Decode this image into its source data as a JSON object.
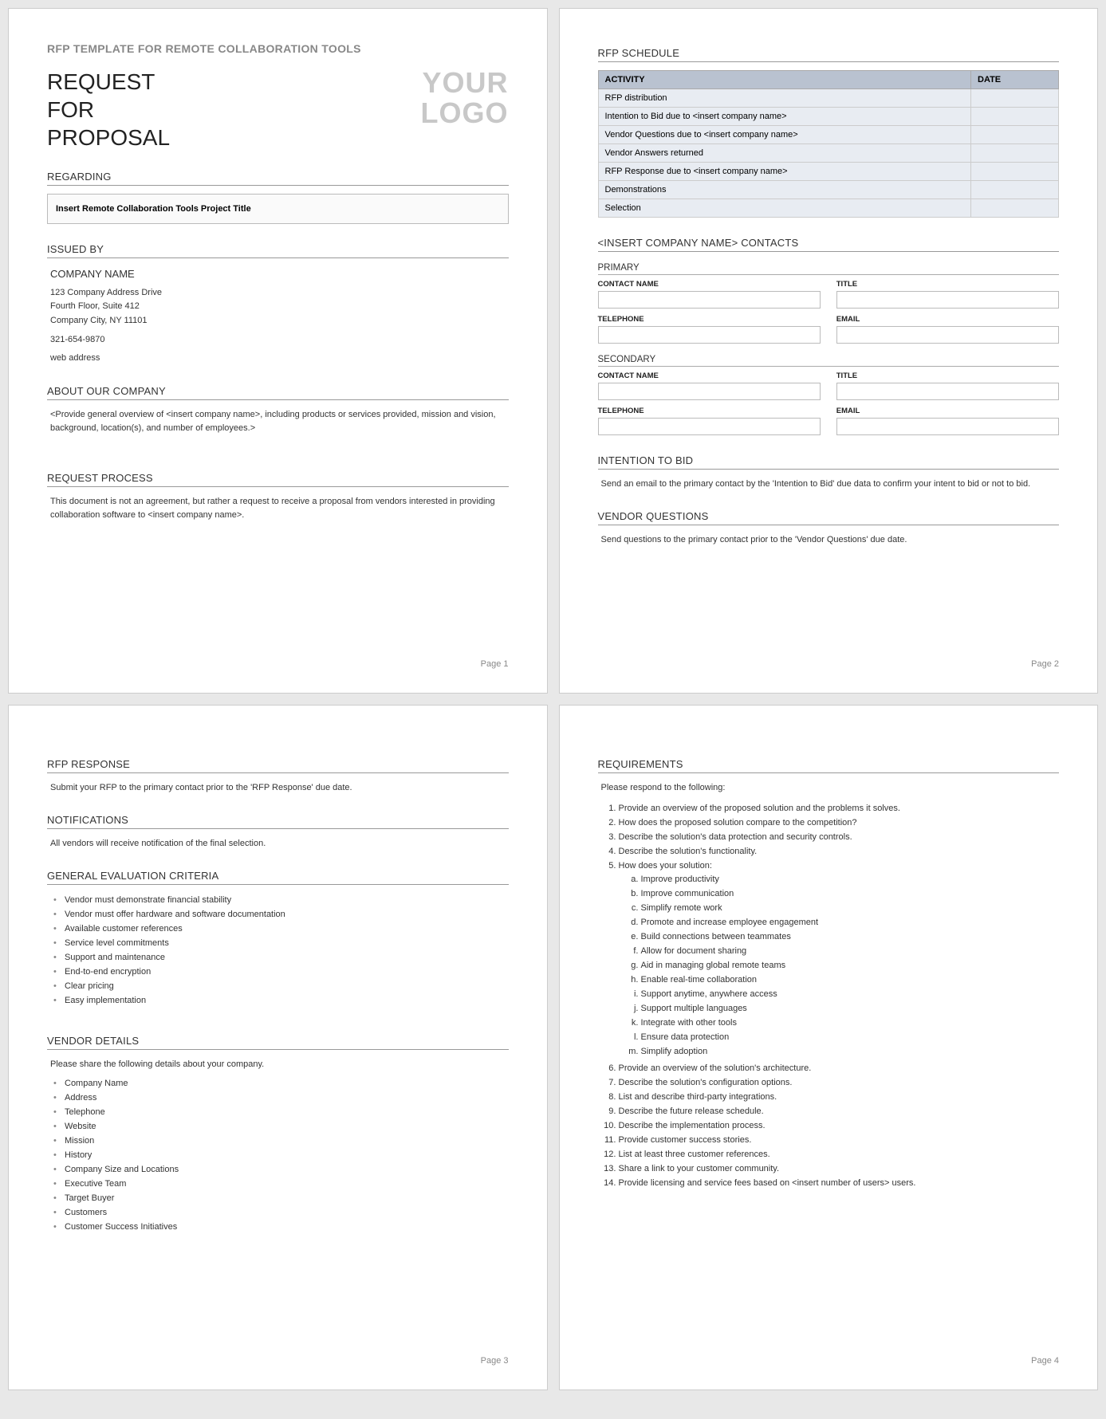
{
  "header": {
    "subtitle": "RFP TEMPLATE FOR REMOTE COLLABORATION TOOLS",
    "title": "REQUEST\nFOR\nPROPOSAL",
    "logo_line1": "YOUR",
    "logo_line2": "LOGO"
  },
  "regarding": {
    "heading": "REGARDING",
    "value": "Insert Remote Collaboration Tools Project Title"
  },
  "issued_by": {
    "heading": "ISSUED BY",
    "company": "COMPANY NAME",
    "addr1": "123 Company Address Drive",
    "addr2": "Fourth Floor, Suite 412",
    "addr3": "Company City, NY  11101",
    "phone": "321-654-9870",
    "web": "web address"
  },
  "about": {
    "heading": "ABOUT OUR COMPANY",
    "text": "<Provide general overview of <insert company name>, including products or services provided, mission and vision, background, location(s), and number of employees.>"
  },
  "process": {
    "heading": "REQUEST PROCESS",
    "text": "This document is not an agreement, but rather a request to receive a proposal from vendors interested in providing collaboration software to <insert company name>."
  },
  "schedule": {
    "heading": "RFP SCHEDULE",
    "col_activity": "ACTIVITY",
    "col_date": "DATE",
    "rows": [
      "RFP distribution",
      "Intention to Bid due to <insert company name>",
      "Vendor Questions due to <insert company name>",
      "Vendor Answers returned",
      "RFP Response due to <insert company name>",
      "Demonstrations",
      "Selection"
    ]
  },
  "contacts": {
    "heading": "<INSERT COMPANY NAME> CONTACTS",
    "primary_label": "PRIMARY",
    "secondary_label": "SECONDARY",
    "lbl_name": "CONTACT NAME",
    "lbl_title": "TITLE",
    "lbl_phone": "TELEPHONE",
    "lbl_email": "EMAIL"
  },
  "intention": {
    "heading": "INTENTION TO BID",
    "text": "Send an email to the primary contact by the 'Intention to Bid' due data to confirm your intent to bid or not to bid."
  },
  "vendor_q": {
    "heading": "VENDOR QUESTIONS",
    "text": "Send questions to the primary contact prior to the 'Vendor Questions' due date."
  },
  "rfp_response": {
    "heading": "RFP RESPONSE",
    "text": "Submit your RFP to the primary contact prior to the 'RFP Response' due date."
  },
  "notifications": {
    "heading": "NOTIFICATIONS",
    "text": "All vendors will receive notification of the final selection."
  },
  "criteria": {
    "heading": "GENERAL EVALUATION CRITERIA",
    "items": [
      "Vendor must demonstrate financial stability",
      "Vendor must offer hardware and software documentation",
      "Available customer references",
      "Service level commitments",
      "Support and maintenance",
      "End-to-end encryption",
      "Clear pricing",
      "Easy implementation"
    ]
  },
  "vendor_details": {
    "heading": "VENDOR DETAILS",
    "intro": "Please share the following details about your company.",
    "items": [
      "Company Name",
      "Address",
      "Telephone",
      "Website",
      "Mission",
      "History",
      "Company Size and Locations",
      "Executive Team",
      "Target Buyer",
      "Customers",
      "Customer Success Initiatives"
    ]
  },
  "requirements": {
    "heading": "REQUIREMENTS",
    "intro": "Please respond to the following:",
    "items": [
      "Provide an overview of the proposed solution and the problems it solves.",
      "How does the proposed solution compare to the competition?",
      "Describe the solution's data protection and security controls.",
      "Describe the solution's functionality.",
      "How does your solution:",
      "Provide an overview of the solution's architecture.",
      "Describe the solution's configuration options.",
      "List and describe third-party integrations.",
      "Describe the future release schedule.",
      "Describe the implementation process.",
      "Provide customer success stories.",
      "List at least three customer references.",
      "Share a link to your customer community.",
      "Provide licensing and service fees based on <insert number of users> users."
    ],
    "subitems": [
      "Improve productivity",
      "Improve communication",
      "Simplify remote work",
      "Promote and increase employee engagement",
      "Build connections between teammates",
      "Allow for document sharing",
      "Aid in managing global remote teams",
      "Enable real-time collaboration",
      "Support anytime, anywhere access",
      "Support multiple languages",
      "Integrate with other tools",
      "Ensure data protection",
      "Simplify adoption"
    ]
  },
  "page_labels": {
    "p1": "Page 1",
    "p2": "Page 2",
    "p3": "Page 3",
    "p4": "Page 4"
  }
}
